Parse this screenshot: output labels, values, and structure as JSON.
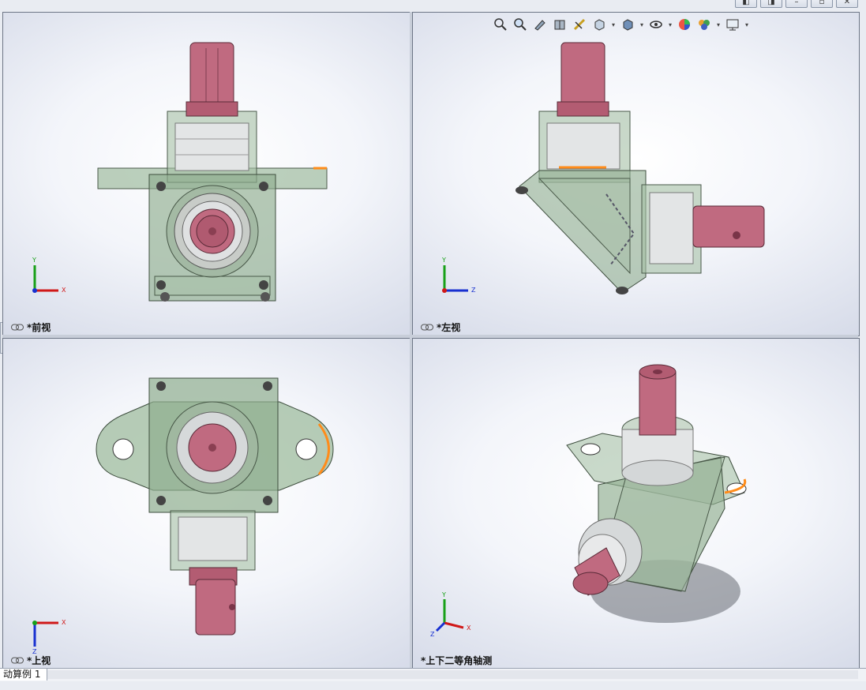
{
  "window": {
    "controls": [
      "prev-window",
      "next-window",
      "minimize",
      "restore",
      "close"
    ]
  },
  "toolbar": {
    "icons": [
      {
        "name": "zoom-to-fit-icon",
        "dropdown": false
      },
      {
        "name": "zoom-to-area-icon",
        "dropdown": false
      },
      {
        "name": "previous-view-icon",
        "dropdown": false
      },
      {
        "name": "section-view-icon",
        "dropdown": false
      },
      {
        "name": "dynamic-annotation-icon",
        "dropdown": false
      },
      {
        "name": "view-orientation-icon",
        "dropdown": true
      },
      {
        "name": "display-style-icon",
        "dropdown": true
      },
      {
        "name": "hide-show-items-icon",
        "dropdown": true
      },
      {
        "name": "edit-appearance-icon",
        "dropdown": false
      },
      {
        "name": "apply-scene-icon",
        "dropdown": true
      },
      {
        "name": "view-settings-icon",
        "dropdown": true
      }
    ]
  },
  "viewports": {
    "front": {
      "label": "*前视",
      "triad": [
        "Y",
        "X"
      ]
    },
    "left": {
      "label": "*左视",
      "triad": [
        "Y",
        "Z"
      ]
    },
    "top": {
      "label": "*上视",
      "triad": [
        "X",
        "Z"
      ]
    },
    "iso": {
      "label": "*上下二等角轴测",
      "triad": [
        "Y",
        "Z",
        "X"
      ]
    }
  },
  "bottom_tab": {
    "label": "动算例 1"
  },
  "colors": {
    "housing": "#8fb08f",
    "shaft": "#b85d74",
    "bearing": "#d9dcdf",
    "highlight": "#ff8c1a",
    "axis_x": "#d01818",
    "axis_y": "#18a018",
    "axis_z": "#1830d0"
  }
}
